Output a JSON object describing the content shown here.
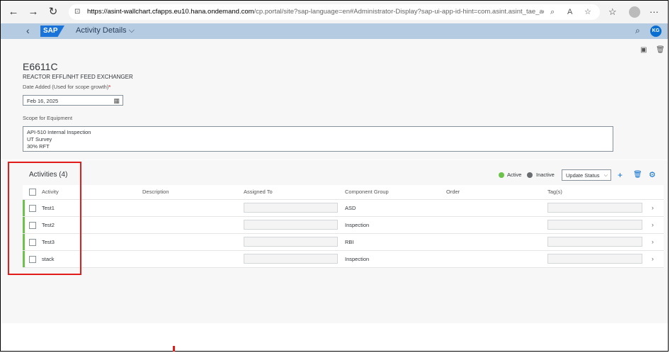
{
  "browser": {
    "url_host": "https://asint-wallchart.cfapps.eu10.hana.ondemand.com",
    "url_path": "/cp.portal/site?sap-language=en#Administrator-Display?sap-ui-app-id-hint=com.asint.asint_tae_admin&/Act..."
  },
  "shell": {
    "logo": "SAP",
    "title": "Activity Details",
    "title_chevron": "⌵",
    "user_initials": "KG"
  },
  "equipment": {
    "id": "E6611C",
    "description": "REACTOR EFFL/NHT FEED EXCHANGER",
    "date_label": "Date Added (Used for scope growth)",
    "date_required": "*",
    "date_value": "Feb 16, 2025",
    "scope_label": "Scope for Equipment",
    "scope_lines": [
      "API-510 Internal Inspection",
      "UT Survey",
      "30% RFT"
    ]
  },
  "activities": {
    "title": "Activities (4)",
    "legend_active": "Active",
    "legend_inactive": "Inactive",
    "update_status": "Update Status",
    "columns": {
      "activity": "Activity",
      "description": "Description",
      "assigned_to": "Assigned To",
      "component_group": "Component Group",
      "order": "Order",
      "tags": "Tag(s)"
    },
    "rows": [
      {
        "activity": "Test1",
        "component_group": "ASD"
      },
      {
        "activity": "Test2",
        "component_group": "Inspection"
      },
      {
        "activity": "Test3",
        "component_group": "RBI"
      },
      {
        "activity": "stack",
        "component_group": "Inspection"
      }
    ]
  },
  "colors": {
    "active": "#6cc24a",
    "inactive": "#6a6d70",
    "accent": "#0a6ed1",
    "highlight": "#e21b1b"
  }
}
